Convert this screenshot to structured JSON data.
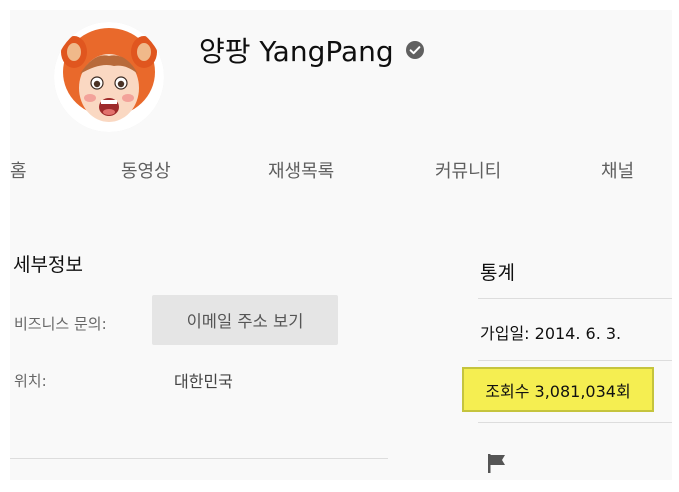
{
  "header": {
    "channel_name": "양팡 YangPang",
    "verified": true
  },
  "tabs": [
    "홈",
    "동영상",
    "재생목록",
    "커뮤니티",
    "채널"
  ],
  "details": {
    "title": "세부정보",
    "business_label": "비즈니스 문의:",
    "email_button": "이메일 주소 보기",
    "location_label": "위치:",
    "location_value": "대한민국"
  },
  "stats": {
    "title": "통계",
    "joined": "가입일: 2014. 6. 3.",
    "views": "조회수 3,081,034회"
  },
  "icons": {
    "verified": "check-circle-icon",
    "report": "flag-icon"
  },
  "colors": {
    "highlight": "#f5ee51",
    "highlight_border": "#c5c43d",
    "background": "#f9f9f9",
    "button_bg": "#e5e5e5"
  }
}
